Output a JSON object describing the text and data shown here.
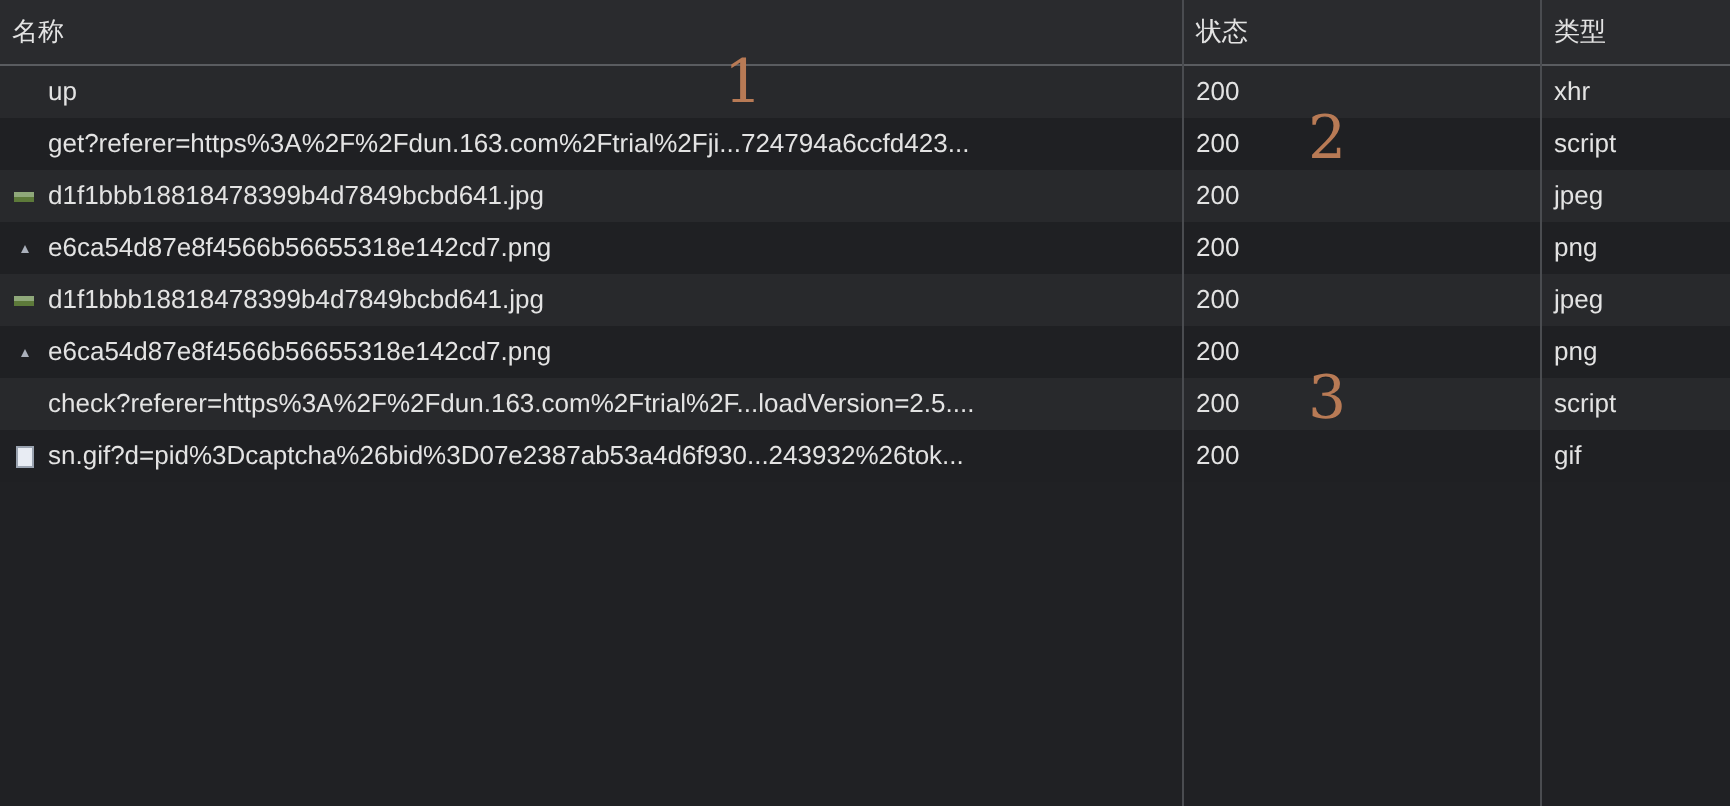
{
  "columns": [
    "名称",
    "状态",
    "类型"
  ],
  "rows": [
    {
      "kind": "plain",
      "name": "up",
      "status": "200",
      "resource_type": "xhr",
      "name_note": "1"
    },
    {
      "kind": "plain",
      "name": "get?referer=https%3A%2F%2Fdun.163.com%2Ftrial%2Fji...724794a6ccfd423...",
      "status": "200",
      "resource_type": "script",
      "status_note": "2"
    },
    {
      "kind": "photo",
      "name": "d1f1bbb18818478399b4d7849bcbd641.jpg",
      "status": "200",
      "resource_type": "jpeg"
    },
    {
      "kind": "sprite",
      "name": "e6ca54d87e8f4566b56655318e142cd7.png",
      "status": "200",
      "resource_type": "png"
    },
    {
      "kind": "photo",
      "name": "d1f1bbb18818478399b4d7849bcbd641.jpg",
      "status": "200",
      "resource_type": "jpeg"
    },
    {
      "kind": "sprite",
      "name": "e6ca54d87e8f4566b56655318e142cd7.png",
      "status": "200",
      "resource_type": "png"
    },
    {
      "kind": "plain",
      "name": "check?referer=https%3A%2F%2Fdun.163.com%2Ftrial%2F...loadVersion=2.5....",
      "status": "200",
      "resource_type": "script",
      "status_note": "3"
    },
    {
      "kind": "page",
      "name": "sn.gif?d=pid%3Dcaptcha%26bid%3D07e2387ab53a4d6f930...243932%26tok...",
      "status": "200",
      "resource_type": "gif"
    }
  ]
}
